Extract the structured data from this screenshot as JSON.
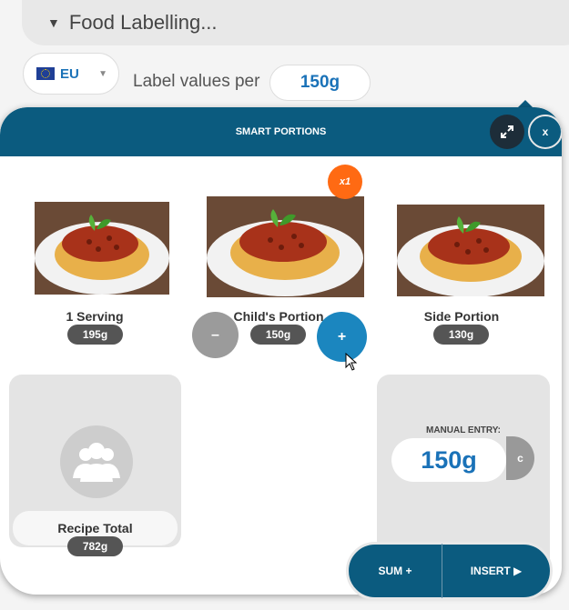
{
  "header": {
    "title": "Food Labelling...",
    "region": "EU",
    "label_values_per": "Label values per",
    "per_value": "150g"
  },
  "panel": {
    "title": "SMART PORTIONS",
    "close_label": "x"
  },
  "portions": [
    {
      "name": "1 Serving",
      "weight": "195g"
    },
    {
      "name": "Child's Portion",
      "weight": "150g",
      "multiplier": "x1"
    },
    {
      "name": "Side Portion",
      "weight": "130g"
    }
  ],
  "controls": {
    "minus": "–",
    "plus": "+"
  },
  "recipe": {
    "label": "Recipe Total",
    "weight": "782g"
  },
  "manual": {
    "label": "MANUAL ENTRY:",
    "value": "150g",
    "clear": "c"
  },
  "actions": {
    "sum": "SUM +",
    "insert": "INSERT ▶"
  },
  "colors": {
    "brand": "#0b5b7f",
    "accent": "#1b86bf",
    "badge": "#ff6a13"
  }
}
